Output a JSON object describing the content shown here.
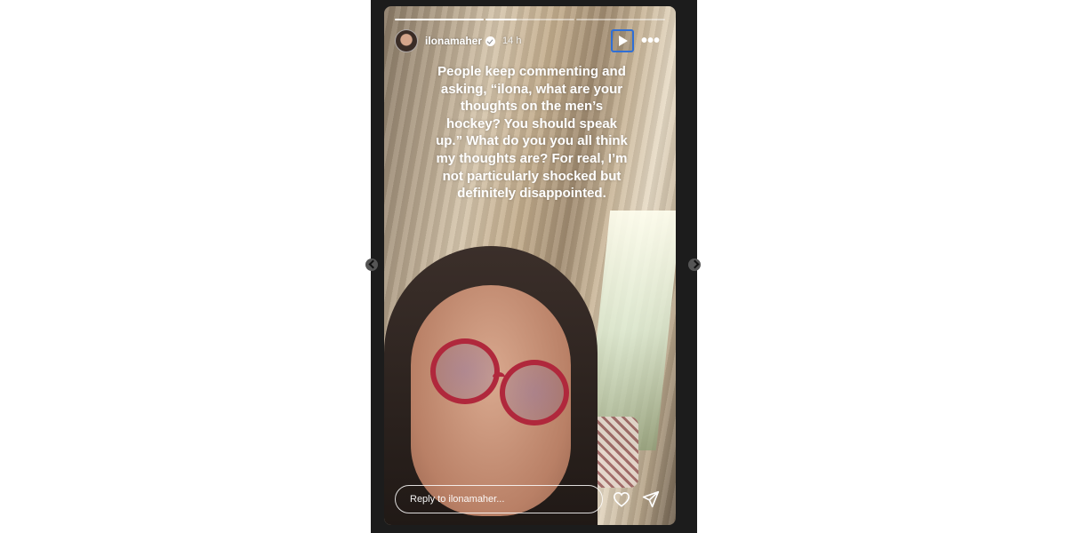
{
  "story": {
    "progress": [
      1.0,
      0.35,
      0.0
    ],
    "username": "ilonamaher",
    "verified": true,
    "time_ago": "14 h",
    "caption": "People keep commenting and asking, “ilona, what are your thoughts on the men’s hockey? You should speak up.” What do you you all think my thoughts are? For real, I’m not particularly shocked but definitely disappointed.",
    "reply_placeholder": "Reply to ilonamaher..."
  },
  "controls": {
    "play_icon": "play-icon",
    "more_icon": "more-options-icon",
    "like_icon": "heart-icon",
    "share_icon": "send-icon"
  },
  "colors": {
    "focus_outline": "#2f6fd6",
    "glasses": "#b0283c",
    "stage_background": "#1c1c1c"
  }
}
